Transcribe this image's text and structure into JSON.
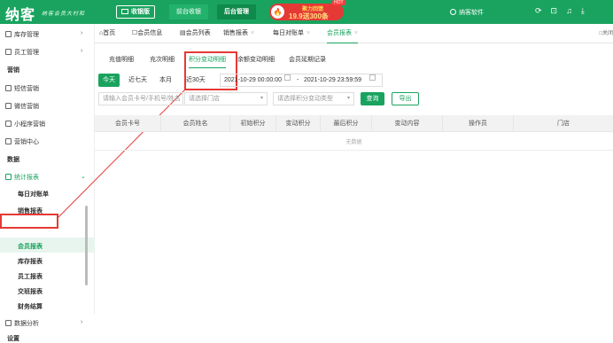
{
  "topbar": {
    "logo": "纳客",
    "slogan": "纳客会员大村和",
    "cashier_label": "收银版",
    "front_tab": "前台收银",
    "back_tab": "后台管理",
    "promo_line1": "聚力回馈",
    "promo_line2": "19.9送300条",
    "promo_hot": "HOT",
    "user": "纳客软件",
    "icons": [
      "refresh-icon",
      "lock-icon",
      "bell-icon",
      "download-icon"
    ]
  },
  "page_tabs": [
    {
      "label": "首页",
      "icon": "home-icon"
    },
    {
      "label": "会员信息",
      "icon": "member-icon"
    },
    {
      "label": "会员列表",
      "icon": "list-icon"
    },
    {
      "label": "销售报表"
    },
    {
      "label": "每日对账单"
    },
    {
      "label": "会员报表",
      "active": true
    }
  ],
  "close_all": "□关闭",
  "sidebar": {
    "items": [
      {
        "label": "库存管理"
      },
      {
        "label": "员工管理"
      },
      {
        "label": "营销"
      },
      {
        "label": "短信营销"
      },
      {
        "label": "微信营销"
      },
      {
        "label": "小程序营销"
      },
      {
        "label": "营销中心"
      },
      {
        "label": "数据"
      },
      {
        "label": "统计报表"
      },
      {
        "label": "每日对账单"
      },
      {
        "label": "销售报表"
      },
      {
        "label": "会员报表"
      },
      {
        "label": "库存报表"
      },
      {
        "label": "员工报表"
      },
      {
        "label": "交班报表"
      },
      {
        "label": "财务结算"
      },
      {
        "label": "数据分析"
      },
      {
        "label": "设置"
      }
    ]
  },
  "sub_tabs": [
    "充值明细",
    "充次明细",
    "积分变动明细",
    "余额变动明细",
    "会员延期记录"
  ],
  "date_buttons": [
    "今天",
    "近七天",
    "本月",
    "近30天"
  ],
  "date_range": {
    "start": "2021-10-29 00:00:00",
    "sep": "-",
    "end": "2021-10-29 23:59:59"
  },
  "filters": {
    "member_placeholder": "请输入会员卡号/手机号/姓名",
    "store_placeholder": "请选择门店",
    "type_placeholder": "请选择积分变动类型",
    "search": "查询",
    "export": "导出"
  },
  "table": {
    "columns": [
      "会员卡号",
      "会员姓名",
      "初始积分",
      "变动积分",
      "最后积分",
      "变动内容",
      "操作员",
      "门店"
    ],
    "empty_text": "无数据"
  },
  "colors": {
    "brand": "#1aa35f",
    "highlight": "#e53935"
  }
}
